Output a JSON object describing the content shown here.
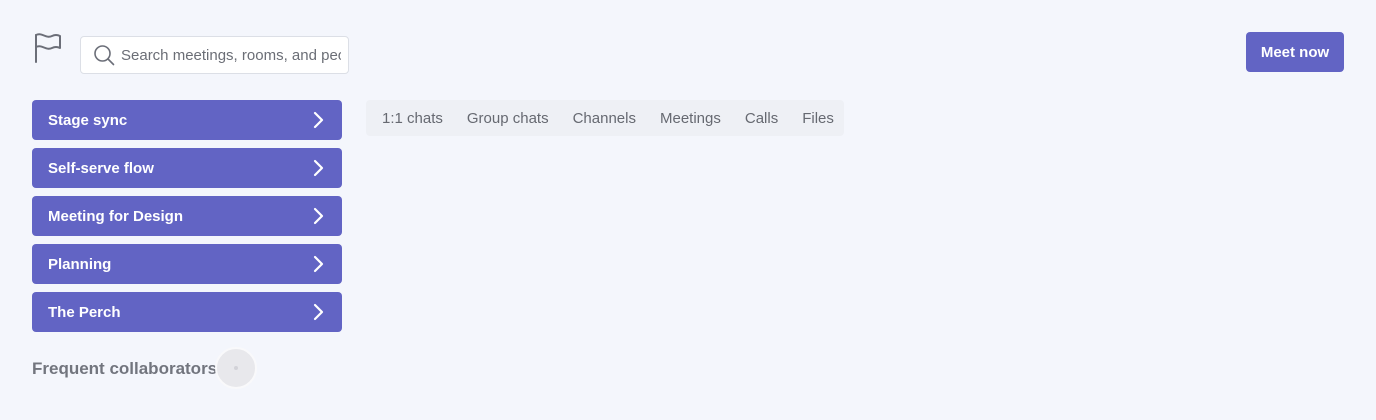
{
  "header": {
    "logo_icon": "flag-icon",
    "search": {
      "placeholder": "Search meetings, rooms, and people",
      "value": "",
      "icon": "search-icon"
    },
    "meet_now_label": "Meet now"
  },
  "rooms": [
    {
      "label": "Stage sync",
      "icon": "chevron-right-icon"
    },
    {
      "label": "Self-serve flow",
      "icon": "chevron-right-icon"
    },
    {
      "label": "Meeting for Design",
      "icon": "chevron-right-icon"
    },
    {
      "label": "Planning",
      "icon": "chevron-right-icon"
    },
    {
      "label": "The Perch",
      "icon": "chevron-right-icon"
    }
  ],
  "tabs": [
    {
      "label": "1:1 chats"
    },
    {
      "label": "Group chats"
    },
    {
      "label": "Channels"
    },
    {
      "label": "Meetings"
    },
    {
      "label": "Calls"
    },
    {
      "label": "Files"
    }
  ],
  "collaborators": {
    "label": "Frequent collaborators"
  },
  "colors": {
    "accent": "#6264c4",
    "background": "#f4f6fc",
    "tab_bar": "#eef0f5"
  }
}
